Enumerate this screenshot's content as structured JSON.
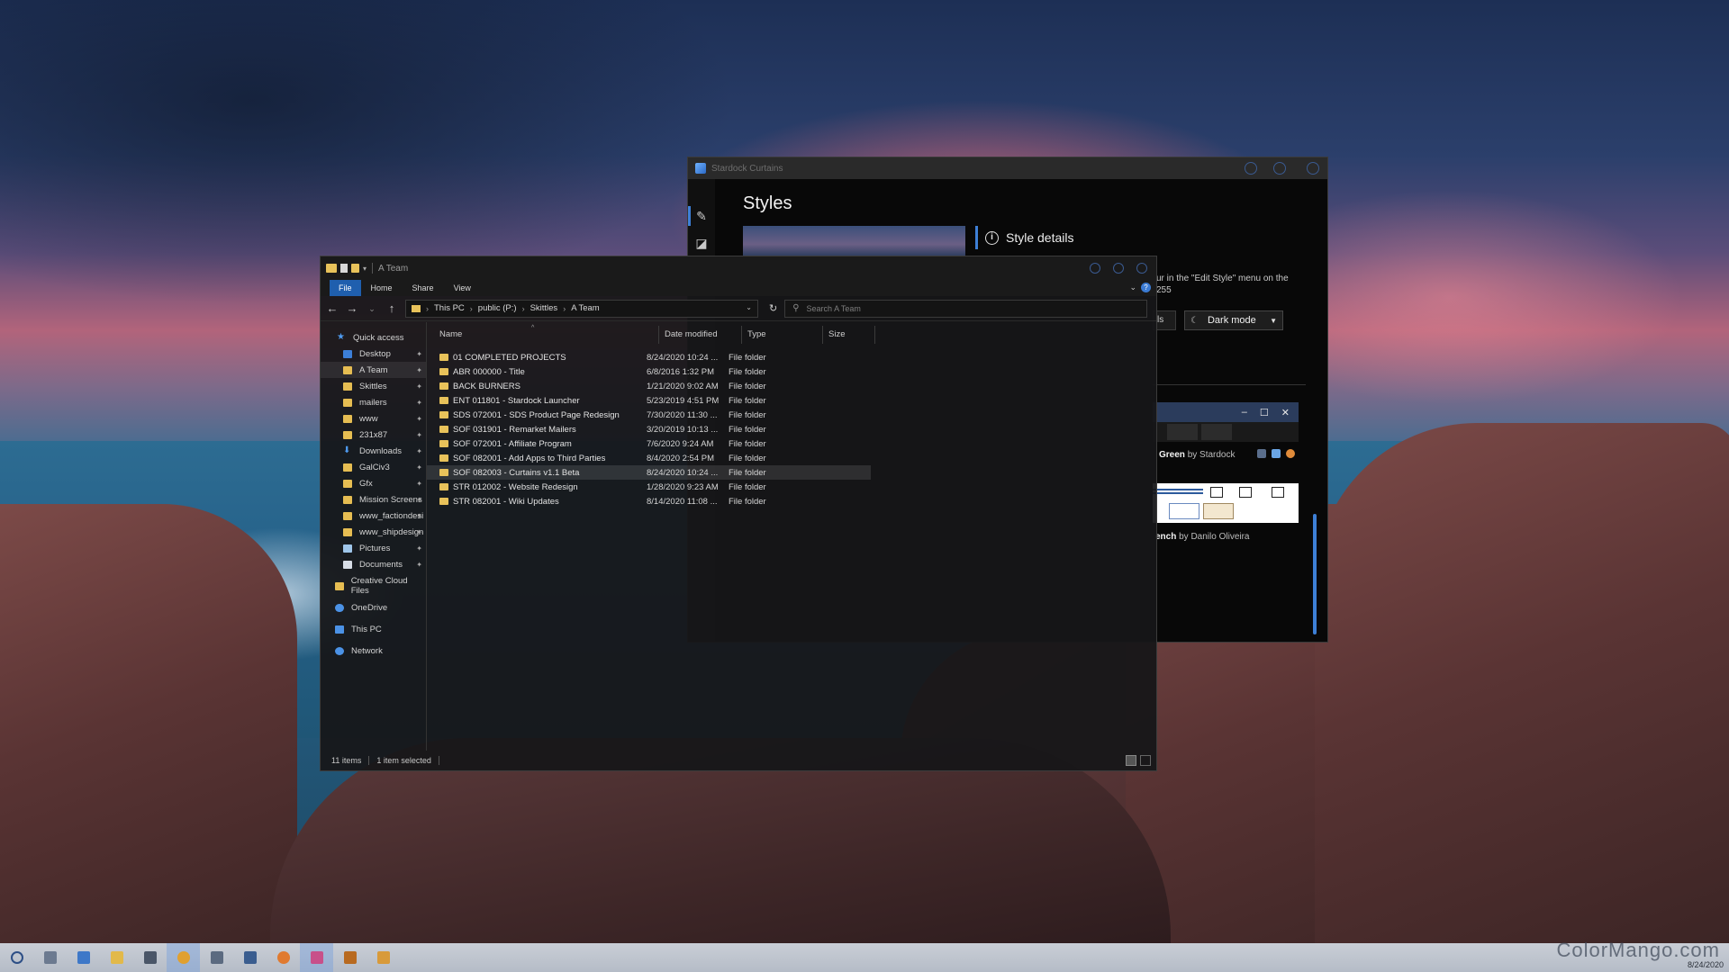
{
  "colors": {
    "accent": "#3d7fd6",
    "folder": "#e8c25a",
    "window_bg": "#161618",
    "taskbar": "#c2c8d1"
  },
  "curtains": {
    "title": "Stardock Curtains",
    "rail_icons": [
      "edit-style-icon",
      "styles-icon",
      "settings-icon"
    ],
    "heading": "Styles",
    "details_label": "Style details",
    "description": "ur in the \"Edit Style\" menu on the\n255",
    "left_button": "ls",
    "mode": "Dark mode",
    "style1": {
      "name": "Green",
      "by": "by Stardock"
    },
    "style2": {
      "name": "ench",
      "by": "by Danilo Oliveira"
    },
    "preview_controls": [
      "–",
      "☐",
      "✕"
    ]
  },
  "explorer": {
    "title": "A Team",
    "tabs": [
      "File",
      "Home",
      "Share",
      "View"
    ],
    "breadcrumb": [
      "This PC",
      "public (P:)",
      "Skittles",
      "A Team"
    ],
    "search_placeholder": "Search A Team",
    "nav": {
      "quick_access": "Quick access",
      "pinned": [
        "Desktop",
        "A Team",
        "Skittles",
        "mailers",
        "www",
        "231x87",
        "Downloads",
        "GalCiv3",
        "Gfx",
        "Mission Screens",
        "www_factiondesi",
        "www_shipdesign",
        "Pictures",
        "Documents"
      ],
      "creative_cloud": "Creative Cloud Files",
      "onedrive": "OneDrive",
      "this_pc": "This PC",
      "network": "Network"
    },
    "columns": {
      "name": "Name",
      "date": "Date modified",
      "type": "Type",
      "size": "Size"
    },
    "rows": [
      {
        "name": "01 COMPLETED PROJECTS",
        "date": "8/24/2020 10:24 ...",
        "type": "File folder"
      },
      {
        "name": "ABR 000000 - Title",
        "date": "6/8/2016 1:32 PM",
        "type": "File folder"
      },
      {
        "name": "BACK BURNERS",
        "date": "1/21/2020 9:02 AM",
        "type": "File folder"
      },
      {
        "name": "ENT 011801 - Stardock Launcher",
        "date": "5/23/2019 4:51 PM",
        "type": "File folder"
      },
      {
        "name": "SDS 072001 - SDS Product Page Redesign",
        "date": "7/30/2020 11:30 ...",
        "type": "File folder"
      },
      {
        "name": "SOF 031901 - Remarket Mailers",
        "date": "3/20/2019 10:13 ...",
        "type": "File folder"
      },
      {
        "name": "SOF 072001 - Affiliate Program",
        "date": "7/6/2020 9:24 AM",
        "type": "File folder"
      },
      {
        "name": "SOF 082001 - Add Apps to Third Parties",
        "date": "8/4/2020 2:54 PM",
        "type": "File folder"
      },
      {
        "name": "SOF 082003 - Curtains v1.1 Beta",
        "date": "8/24/2020 10:24 ...",
        "type": "File folder"
      },
      {
        "name": "STR 012002 - Website Redesign",
        "date": "1/28/2020 9:23 AM",
        "type": "File folder"
      },
      {
        "name": "STR 082001 - Wiki Updates",
        "date": "8/14/2020 11:08 ...",
        "type": "File folder"
      }
    ],
    "status": {
      "count": "11 items",
      "selected": "1 item selected"
    }
  },
  "taskbar": {
    "apps": [
      "start-icon",
      "task-view-icon",
      "mail-icon",
      "file-explorer-icon",
      "store-icon",
      "chrome-icon",
      "notepad-icon",
      "photoshop-icon",
      "firefox-icon",
      "curtains-icon",
      "illustrator-icon",
      "stardock-icon"
    ],
    "watermark": "ColorMango.com",
    "date": "8/24/2020"
  }
}
